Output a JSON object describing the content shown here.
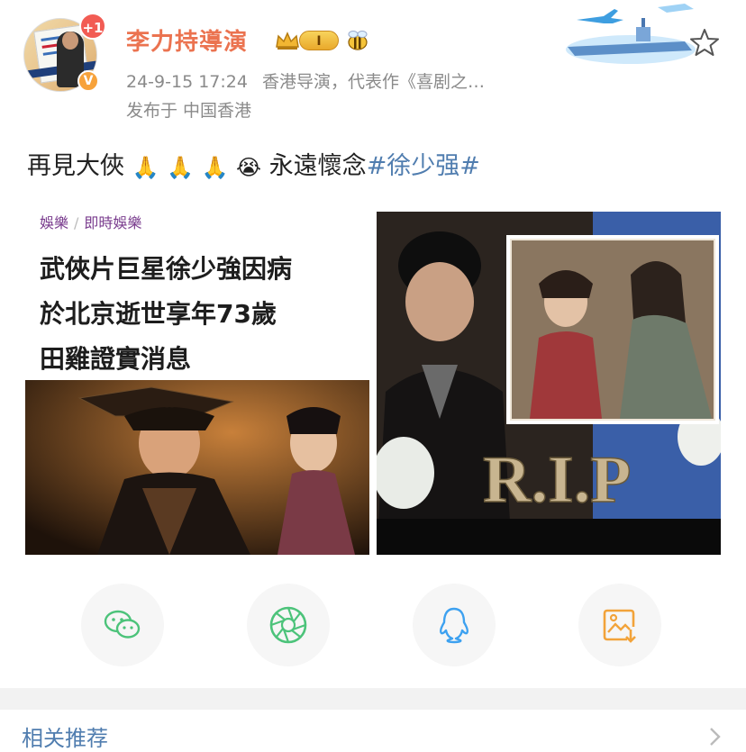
{
  "post": {
    "author": "李力持導演",
    "avatar_badge": "+1",
    "verified_badge": "V",
    "level": "I",
    "timestamp": "24-9-15 17:24",
    "bio": "香港导演，代表作《喜剧之…",
    "location": "发布于 中国香港",
    "avatar_poster_lines": [
      "李力持",
      "Lee Lik Chee Movie"
    ],
    "text_prefix": "再見大俠",
    "text_middle": "永遠懷念",
    "hashtag": "#徐少强#",
    "emoji_pray": "🙏",
    "emoji_cry": "😭"
  },
  "article": {
    "crumb_1": "娛樂",
    "crumb_sep": "/",
    "crumb_2": "即時娛樂",
    "headline_line1": "武俠片巨星徐少強因病",
    "headline_line2": "於北京逝世享年73歲",
    "headline_line3": "田雞證實消息"
  },
  "image_right": {
    "overlay_text": "R.I.P"
  },
  "share": [
    {
      "name": "wechat",
      "icon": "wechat-icon",
      "color": "#4cc37a"
    },
    {
      "name": "moments",
      "icon": "moments-icon",
      "color": "#4cc37a"
    },
    {
      "name": "qq",
      "icon": "qq-icon",
      "color": "#3da1f0"
    },
    {
      "name": "save-image",
      "icon": "save-image-icon",
      "color": "#f2a33a"
    }
  ],
  "related": {
    "label": "相关推荐"
  },
  "colors": {
    "accent_name": "#eb7350",
    "link": "#507daf",
    "meta": "#8a8a8a"
  }
}
